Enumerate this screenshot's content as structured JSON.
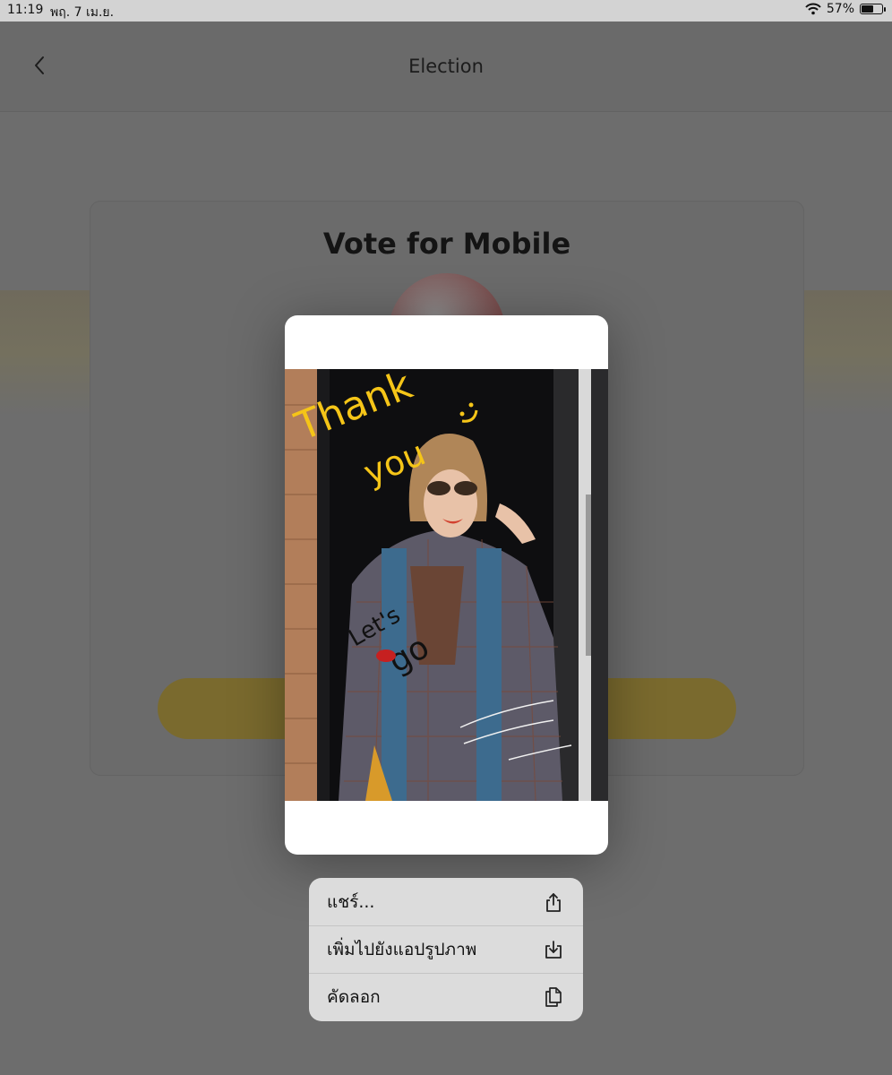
{
  "status_bar": {
    "time": "11:19",
    "date": "พฤ. 7 เม.ย.",
    "battery_percent": "57%",
    "battery_level": 0.57
  },
  "nav": {
    "title": "Election",
    "back_icon": "chevron-left-icon"
  },
  "card": {
    "title": "Vote for Mobile"
  },
  "preview": {
    "handwriting_thank": "Thank",
    "handwriting_you": "you",
    "handwriting_lets": "Let's",
    "handwriting_go": "go"
  },
  "context_menu": {
    "items": [
      {
        "label": "แชร์...",
        "icon": "share-icon"
      },
      {
        "label": "เพิ่มไปยังแอปรูปภาพ",
        "icon": "save-to-photos-icon"
      },
      {
        "label": "คัดลอก",
        "icon": "copy-icon"
      }
    ]
  },
  "colors": {
    "accent_yellow": "#f5c518",
    "dim_overlay": "#6b6b6b",
    "menu_bg": "#dcdcdc"
  }
}
